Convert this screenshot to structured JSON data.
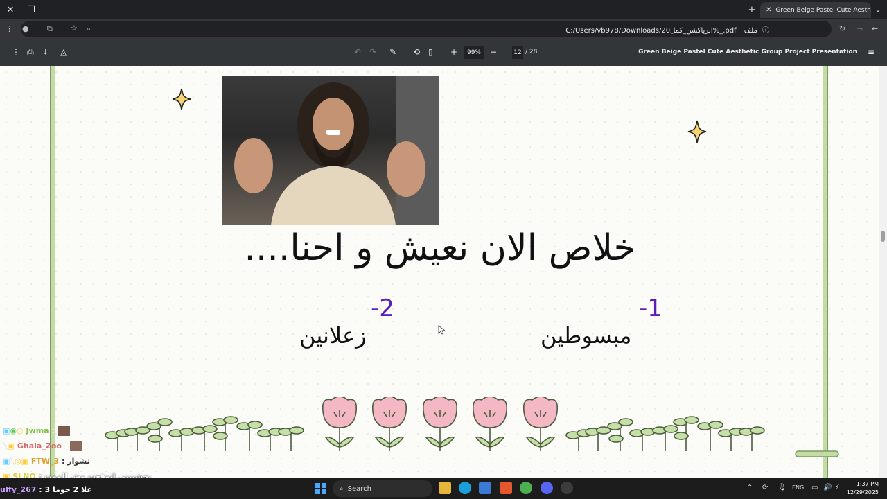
{
  "browser": {
    "tab_title": "Green Beige Pastel Cute Aesthetic Group Project Presentation",
    "url_label": "ملف",
    "url": "C:/Users/vb978/Downloads/الرياكشن_كمل20%_.pdf"
  },
  "pdf_toolbar": {
    "zoom": "99%",
    "page_current": "12",
    "page_total": "/ 28",
    "doc_title": "Green Beige Pastel Cute Aesthetic Group Project Presentation"
  },
  "slide": {
    "headline": "خلاص الان نعيش و احنا....",
    "items": [
      {
        "number": "-1",
        "word": "مبسوطين"
      },
      {
        "number": "-2",
        "word": "زعلانين"
      }
    ]
  },
  "chat": {
    "lines": [
      {
        "user": "Jwma",
        "text": ":",
        "color": "#7fbf3f"
      },
      {
        "user": "Ghala_Zoo",
        "text": ":",
        "color": "#d46a6a"
      },
      {
        "user": "FTW_3",
        "text": ": نشوار",
        "color": "#e0a030"
      },
      {
        "user": "SLNO",
        "text": ": يحشيييي اتوقعت وش الموت",
        "color": "#d0d040"
      },
      {
        "user": "uffy_267",
        "text": ": غلا 2 جوما 3",
        "color": "#c9a0ff"
      }
    ]
  },
  "taskbar": {
    "search_label": "Search",
    "lang": "ENG",
    "time": "1:37 PM",
    "date": "12/29/2025"
  },
  "colors": {
    "accent_purple": "#5a1fb8",
    "stem_green": "#7c9a66",
    "flower_pink": "#f4b8c4"
  }
}
